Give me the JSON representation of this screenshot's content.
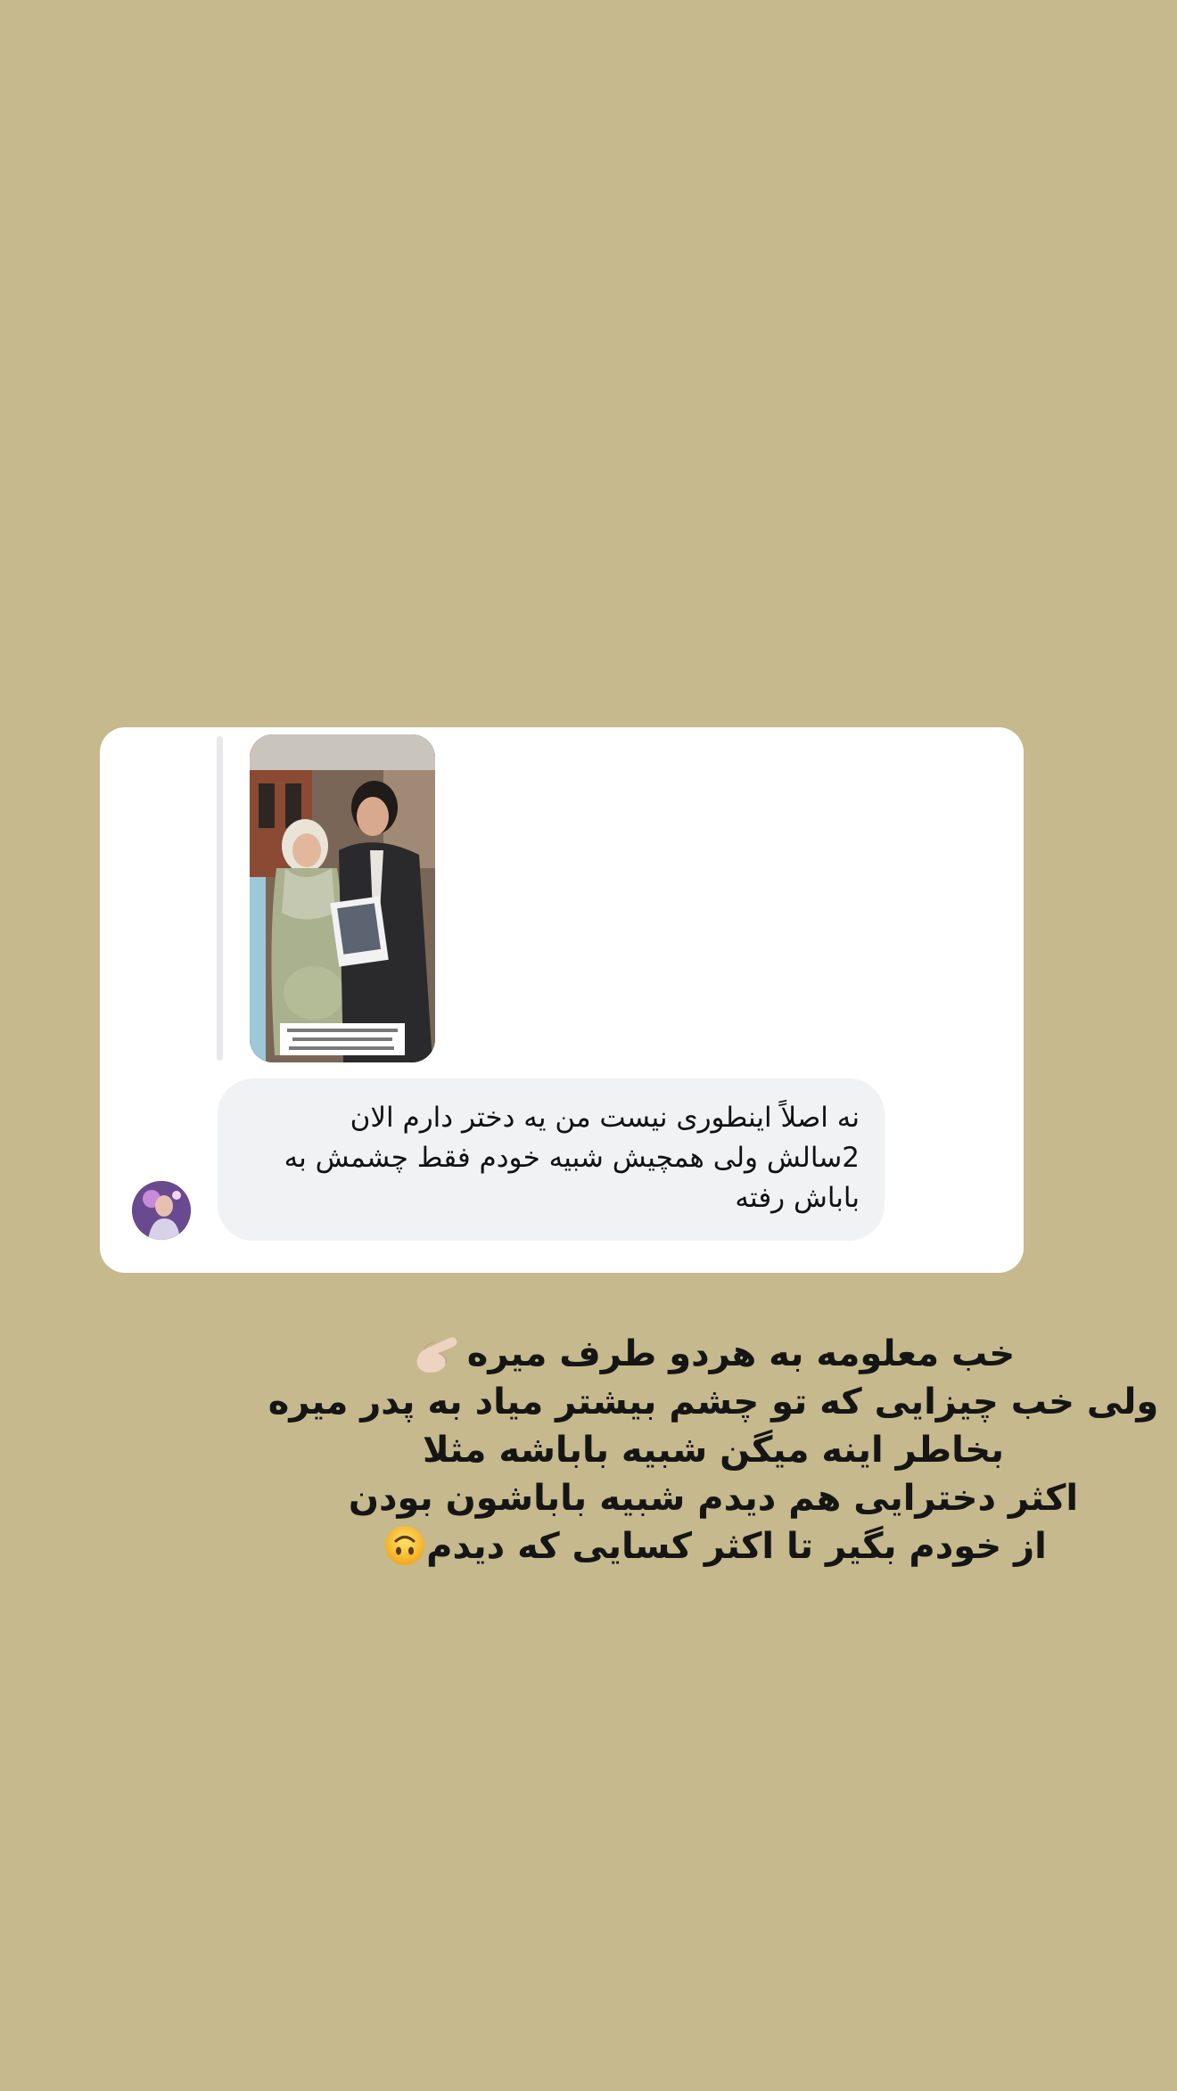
{
  "background_color": "#c5b98d",
  "story_reply": {
    "shared_post": {
      "image_name": "couple-pregnancy-photo",
      "overlay_text_lines": [
        "من مرودیم که دخترا شبیه باباشون میشن 😍",
        "ولی واقعا چرا بچه اول باید شبیه پدر بشه؟!",
        "اینه که شبیه دختراشون بشن تا 😂 بیشتر..."
      ]
    },
    "message": {
      "lines": [
        "نه اصلاً اینطوری نیست من یه دختر دارم الان",
        "2سالش ولی همچیش شبیه خودم فقط چشمش به",
        "باباش رفته"
      ]
    },
    "avatar_name": "sender-avatar"
  },
  "caption": {
    "lines": [
      "خب معلومه به هردو طرف میره",
      "ولی خب چیزایی که تو چشم بیشتر میاد به پدر میره",
      "بخاطر اینه میگن شبیه باباشه مثلا",
      "اکثر دخترایی هم دیدم شبیه باباشون بودن",
      "از خودم بگیر تا اکثر کسایی که دیدم"
    ],
    "line1_emoji": "pinching-hand-emoji",
    "line5_emoji": "upside-down-face-emoji"
  }
}
